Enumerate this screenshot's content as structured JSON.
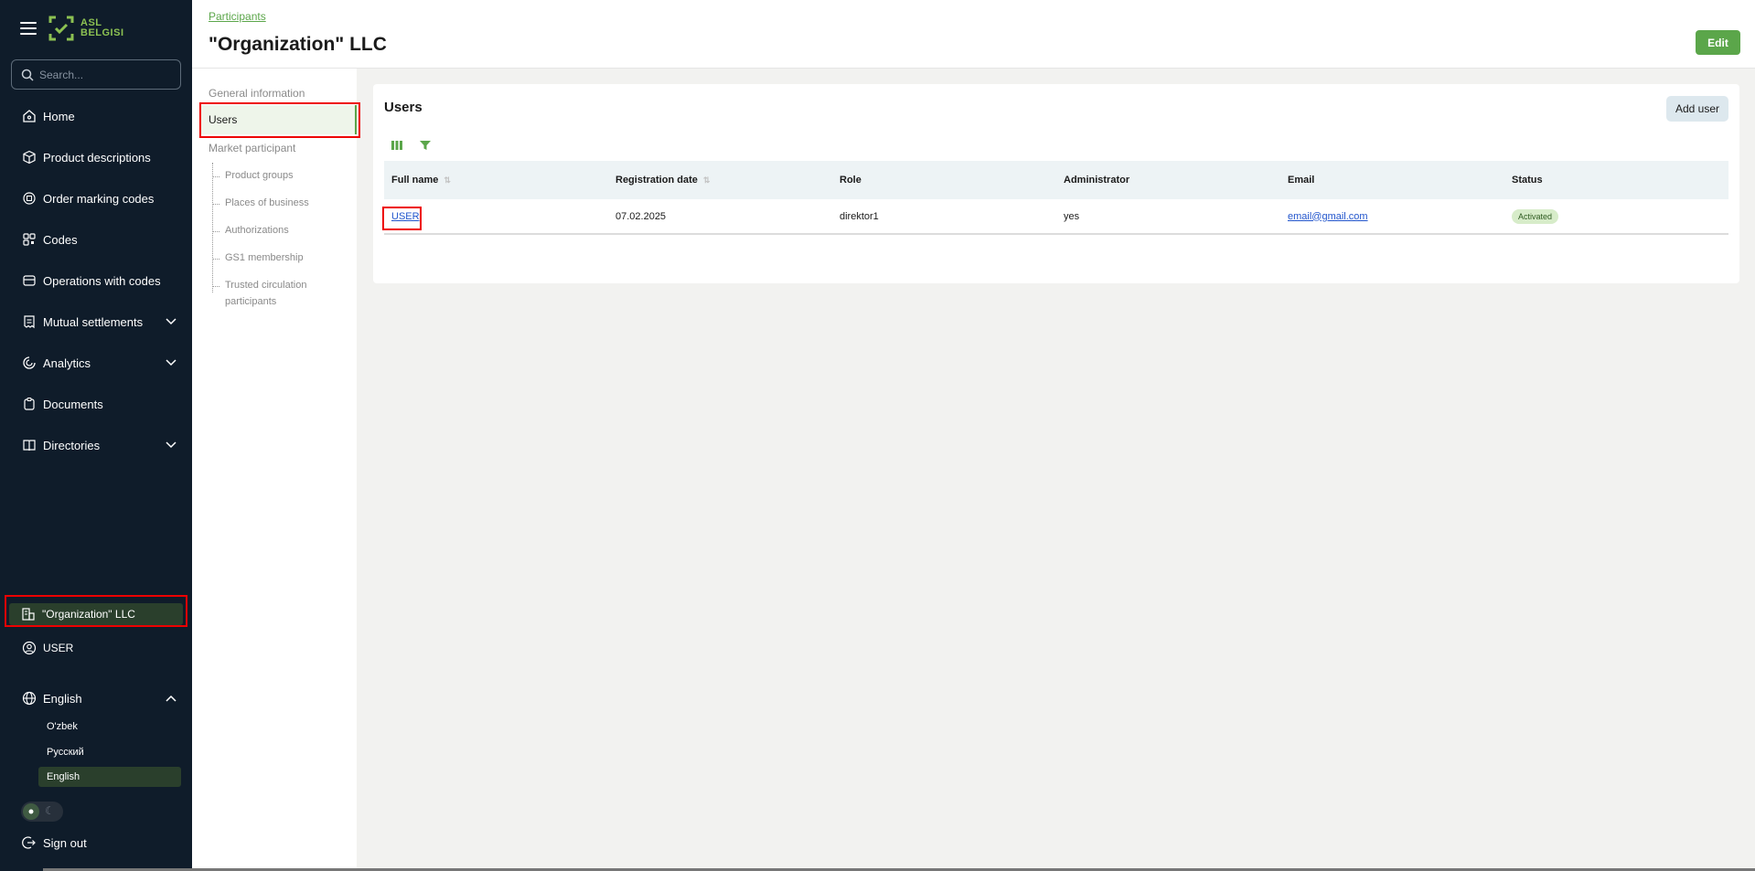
{
  "sidebar": {
    "logo": "ASL BELGISI",
    "search_placeholder": "Search...",
    "nav": [
      {
        "label": "Home",
        "icon": "home-icon"
      },
      {
        "label": "Product descriptions",
        "icon": "cube-icon"
      },
      {
        "label": "Order marking codes",
        "icon": "order-icon"
      },
      {
        "label": "Codes",
        "icon": "qr-icon"
      },
      {
        "label": "Operations with codes",
        "icon": "box-icon"
      },
      {
        "label": "Mutual settlements",
        "icon": "receipt-icon",
        "expandable": true
      },
      {
        "label": "Analytics",
        "icon": "chart-icon",
        "expandable": true
      },
      {
        "label": "Documents",
        "icon": "document-icon"
      },
      {
        "label": "Directories",
        "icon": "book-icon",
        "expandable": true
      }
    ],
    "organization": "\"Organization\" LLC",
    "user": "USER",
    "language": {
      "current": "English",
      "options": [
        "O'zbek",
        "Русский",
        "English"
      ],
      "active": "English"
    },
    "sign_out": "Sign out"
  },
  "header": {
    "breadcrumb": "Participants",
    "title": "\"Organization\" LLC",
    "edit_label": "Edit"
  },
  "subnav": {
    "general": "General information",
    "users": "Users",
    "market": "Market participant",
    "children": [
      "Product groups",
      "Places of business",
      "Authorizations",
      "GS1 membership",
      "Trusted circulation participants"
    ]
  },
  "users_card": {
    "title": "Users",
    "add_label": "Add user",
    "columns": [
      "Full name",
      "Registration date",
      "Role",
      "Administrator",
      "Email",
      "Status"
    ],
    "rows": [
      {
        "full_name": "USER",
        "registration_date": "07.02.2025",
        "role": "direktor1",
        "administrator": "yes",
        "email": "email@gmail.com",
        "status": "Activated"
      }
    ]
  },
  "colors": {
    "sidebar_bg": "#0f1c2a",
    "accent": "#5ba64a",
    "highlight": "#e00000"
  }
}
